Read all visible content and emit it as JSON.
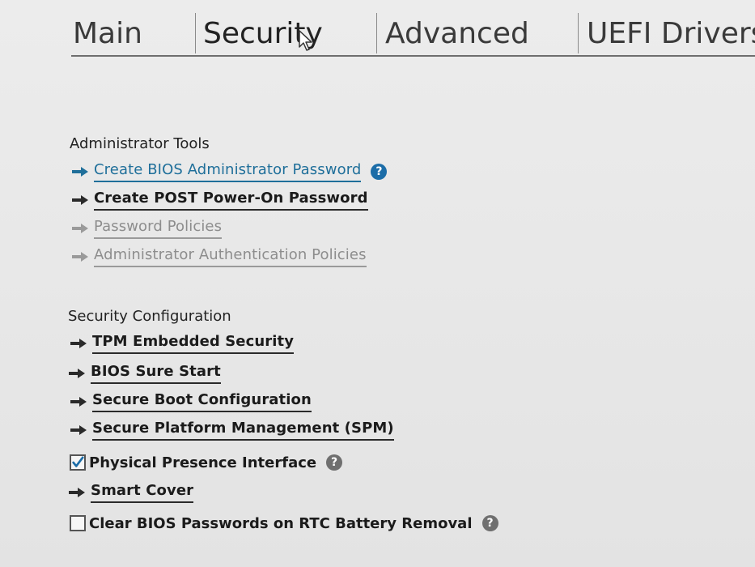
{
  "tabs": [
    {
      "label": "Main"
    },
    {
      "label": "Security",
      "active": true
    },
    {
      "label": "Advanced"
    },
    {
      "label": "UEFI Drivers"
    }
  ],
  "administrator_tools": {
    "title": "Administrator Tools",
    "items": [
      {
        "label": "Create BIOS Administrator Password",
        "state": "selected",
        "help": true
      },
      {
        "label": "Create POST Power-On Password",
        "state": "enabled"
      },
      {
        "label": "Password Policies",
        "state": "disabled"
      },
      {
        "label": "Administrator Authentication Policies",
        "state": "disabled"
      }
    ]
  },
  "security_configuration": {
    "title": "Security Configuration",
    "items": [
      {
        "label": "TPM Embedded Security",
        "type": "link"
      },
      {
        "label": "BIOS Sure Start",
        "type": "link"
      },
      {
        "label": "Secure Boot Configuration",
        "type": "link"
      },
      {
        "label": "Secure Platform Management (SPM)",
        "type": "link"
      },
      {
        "label": "Physical Presence Interface",
        "type": "checkbox",
        "checked": true,
        "help": true
      },
      {
        "label": "Smart Cover",
        "type": "link"
      },
      {
        "label": "Clear BIOS Passwords on RTC Battery Removal",
        "type": "checkbox",
        "checked": false,
        "help": true
      }
    ]
  },
  "colors": {
    "accent": "#1f6f9a",
    "help_blue": "#1c6da8",
    "help_gray": "#6f6f6f",
    "disabled": "#8d8d8d"
  },
  "icons": {
    "arrow": "arrow-right-icon",
    "help": "help-icon",
    "check": "checkmark-icon",
    "cursor": "mouse-pointer-icon"
  }
}
